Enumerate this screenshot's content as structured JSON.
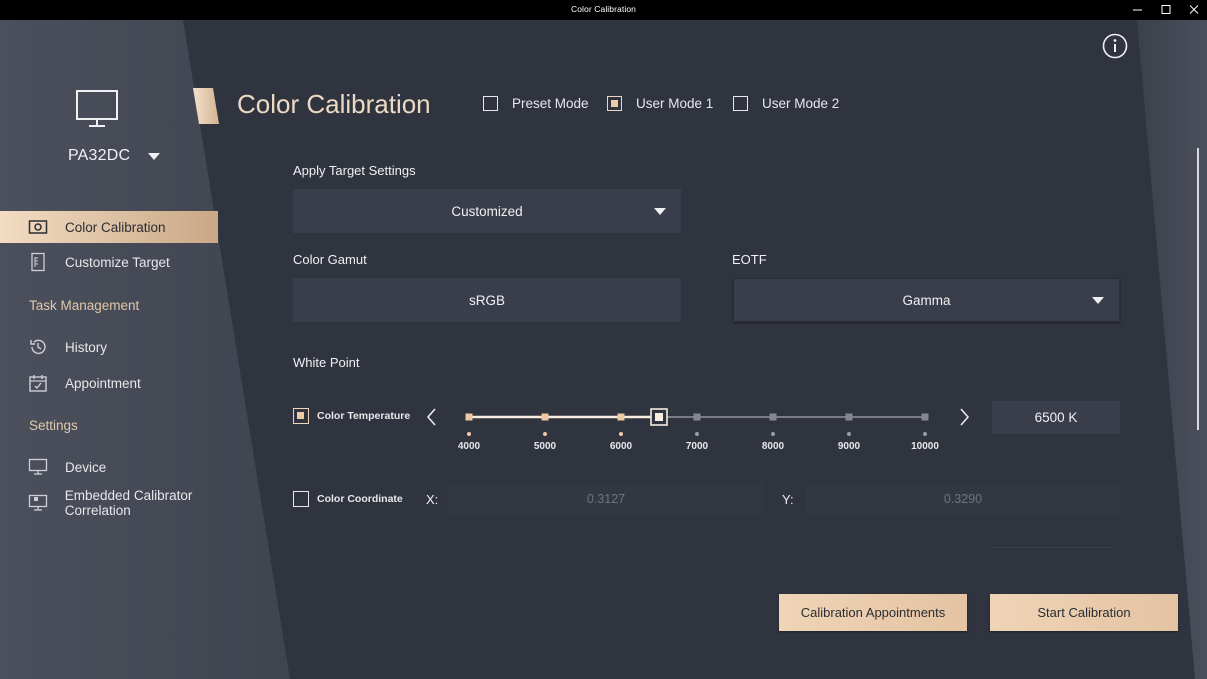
{
  "window": {
    "title": "Color Calibration"
  },
  "device": {
    "name": "PA32DC"
  },
  "sidebar": {
    "items": [
      {
        "label": "Color Calibration",
        "icon": "camera-icon",
        "active": true
      },
      {
        "label": "Customize Target",
        "icon": "document-icon",
        "active": false
      }
    ],
    "task_heading": "Task Management",
    "task_items": [
      {
        "label": "History",
        "icon": "history-icon"
      },
      {
        "label": "Appointment",
        "icon": "calendar-icon"
      }
    ],
    "settings_heading": "Settings",
    "settings_items": [
      {
        "label": "Device",
        "icon": "monitor-icon"
      },
      {
        "label": "Embedded Calibrator Correlation",
        "icon": "monitor-calibrator-icon"
      }
    ]
  },
  "header": {
    "title": "Color Calibration",
    "modes": [
      {
        "label": "Preset Mode",
        "checked": false
      },
      {
        "label": "User Mode 1",
        "checked": true
      },
      {
        "label": "User Mode 2",
        "checked": false
      }
    ]
  },
  "target": {
    "label": "Apply Target Settings",
    "value": "Customized"
  },
  "gamut": {
    "label": "Color Gamut",
    "value": "sRGB"
  },
  "eotf": {
    "label": "EOTF",
    "value": "Gamma"
  },
  "white_point": {
    "label": "White Point",
    "temperature": {
      "label": "Color Temperature",
      "checked": true,
      "ticks": [
        "4000",
        "5000",
        "6000",
        "7000",
        "8000",
        "9000",
        "10000"
      ],
      "selected": 6500,
      "value": "6500  K"
    },
    "coordinate": {
      "label": "Color Coordinate",
      "checked": false,
      "x_label": "X:",
      "x_value": "0.3127",
      "y_label": "Y:",
      "y_value": "0.3290"
    }
  },
  "buttons": {
    "appointments": "Calibration Appointments",
    "start": "Start Calibration"
  },
  "colors": {
    "accent": "#edc9a6",
    "background": "#30343f",
    "sidebar": "#464b57"
  }
}
